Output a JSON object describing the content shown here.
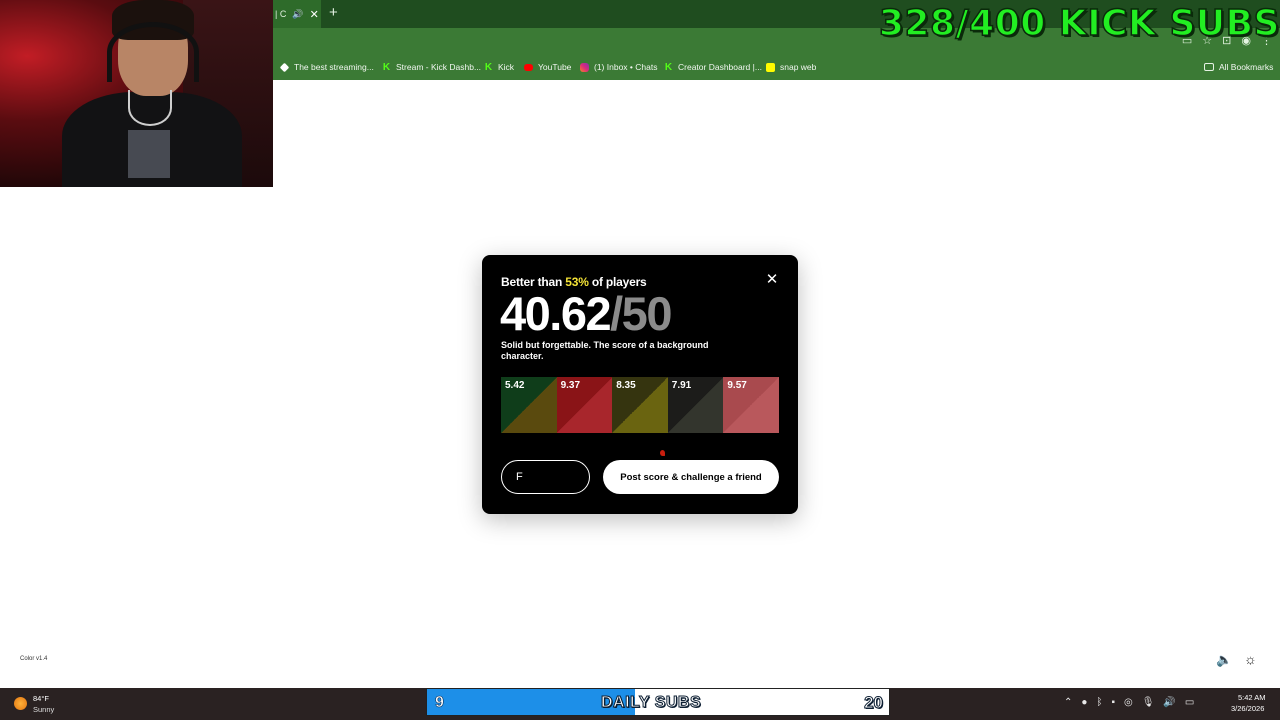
{
  "browser": {
    "tab_fragment": "| C",
    "new_tab": "+",
    "bookmarks": [
      {
        "label": "The best streaming...",
        "icon": "gem-icon"
      },
      {
        "label": "Stream - Kick Dashb...",
        "icon": "kick-icon"
      },
      {
        "label": "Kick",
        "icon": "kick-icon"
      },
      {
        "label": "YouTube",
        "icon": "youtube-icon"
      },
      {
        "label": "(1) Inbox • Chats",
        "icon": "instagram-icon"
      },
      {
        "label": "Creator Dashboard |...",
        "icon": "kick-icon"
      },
      {
        "label": "snap web",
        "icon": "snapchat-icon"
      }
    ],
    "all_bookmarks": "All Bookmarks"
  },
  "overlay": {
    "subs_goal": "328/400 KICK SUBS",
    "daily": {
      "current": "9",
      "label": "DAILY SUBS",
      "target": "20",
      "progress": 0.45
    }
  },
  "modal": {
    "better_prefix": "Better than ",
    "better_pct": "53%",
    "better_suffix": " of players",
    "score": "40.62",
    "score_max": "/50",
    "verdict": "Solid but forgettable. The score of a background character.",
    "swatches": [
      {
        "value": "5.42",
        "target": "#0f3d1a",
        "guess": "#5a4a0e"
      },
      {
        "value": "9.37",
        "target": "#8a1417",
        "guess": "#a8262c"
      },
      {
        "value": "8.35",
        "target": "#35340f",
        "guess": "#6a6410"
      },
      {
        "value": "7.91",
        "target": "#1c1c1a",
        "guess": "#33352d"
      },
      {
        "value": "9.57",
        "target": "#a94a4e",
        "guess": "#b9585c"
      }
    ],
    "name_value": "F",
    "post_label": "Post score & challenge a friend",
    "close_symbol": "✕"
  },
  "page": {
    "version": "Color v1.4"
  },
  "taskbar": {
    "weather_temp": "84°F",
    "weather_cond": "Sunny",
    "time": "5:42 AM",
    "date": "3/26/2026"
  },
  "colors": {
    "subs_green": "#22ee22",
    "highlight_yellow": "#f3e236",
    "daily_fill": "#1d8fe8"
  }
}
